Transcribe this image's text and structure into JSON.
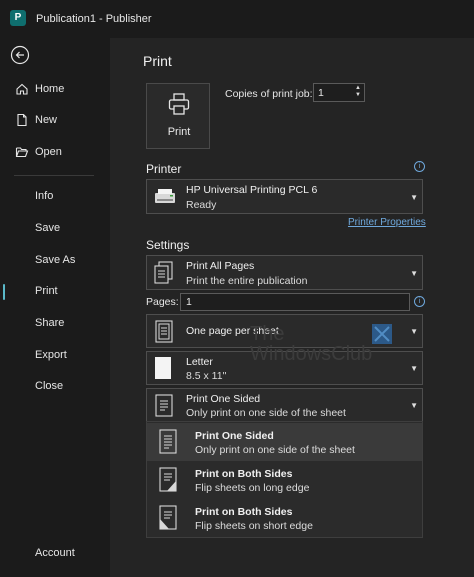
{
  "app": {
    "logo_letter": "P",
    "title": "Publication1  -  Publisher"
  },
  "sidebar": {
    "back_label": "Back",
    "top_items": [
      {
        "label": "Home",
        "icon": "home-icon"
      },
      {
        "label": "New",
        "icon": "new-document-icon"
      },
      {
        "label": "Open",
        "icon": "folder-open-icon"
      }
    ],
    "items": [
      {
        "label": "Info"
      },
      {
        "label": "Save"
      },
      {
        "label": "Save As"
      },
      {
        "label": "Print",
        "active": true
      },
      {
        "label": "Share"
      },
      {
        "label": "Export"
      },
      {
        "label": "Close"
      }
    ],
    "account_label": "Account"
  },
  "print": {
    "heading": "Print",
    "button_label": "Print",
    "copies_label": "Copies of print job:",
    "copies_value": "1"
  },
  "printer": {
    "heading": "Printer",
    "name": "HP Universal Printing PCL 6",
    "status": "Ready",
    "properties_link": "Printer Properties"
  },
  "settings": {
    "heading": "Settings",
    "print_range": {
      "title": "Print All Pages",
      "subtitle": "Print the entire publication"
    },
    "pages_label": "Pages:",
    "pages_value": "1",
    "layout": {
      "title": "One page per sheet"
    },
    "paper": {
      "title": "Letter",
      "subtitle": "8.5 x 11\""
    },
    "sides": {
      "title": "Print One Sided",
      "subtitle": "Only print on one side of the sheet"
    }
  },
  "sides_menu": [
    {
      "title": "Print One Sided",
      "subtitle": "Only print on one side of the sheet",
      "selected": true
    },
    {
      "title": "Print on Both Sides",
      "subtitle": "Flip sheets on long edge"
    },
    {
      "title": "Print on Both Sides",
      "subtitle": "Flip sheets on short edge"
    }
  ],
  "watermark": {
    "line1": "The",
    "line2": "WindowsClub"
  },
  "colors": {
    "accent": "#5ab9c9",
    "link": "#6fa8dc",
    "background": "#242424",
    "sidebar": "#1b1b1b"
  }
}
